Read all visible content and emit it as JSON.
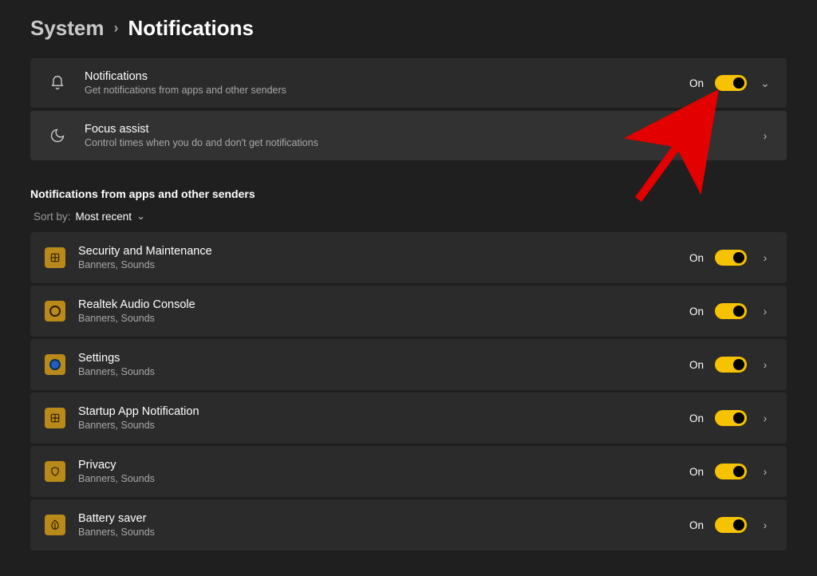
{
  "breadcrumb": {
    "parent": "System",
    "current": "Notifications"
  },
  "main_toggle": {
    "title": "Notifications",
    "subtitle": "Get notifications from apps and other senders",
    "state": "On"
  },
  "focus": {
    "title": "Focus assist",
    "subtitle": "Control times when you do and don't get notifications"
  },
  "section_heading": "Notifications from apps and other senders",
  "sort": {
    "label": "Sort by:",
    "value": "Most recent"
  },
  "apps": [
    {
      "name": "Security and Maintenance",
      "sub": "Banners, Sounds",
      "state": "On",
      "icon": "grid"
    },
    {
      "name": "Realtek Audio Console",
      "sub": "Banners, Sounds",
      "state": "On",
      "icon": "circle"
    },
    {
      "name": "Settings",
      "sub": "Banners, Sounds",
      "state": "On",
      "icon": "blue-dot"
    },
    {
      "name": "Startup App Notification",
      "sub": "Banners, Sounds",
      "state": "On",
      "icon": "grid"
    },
    {
      "name": "Privacy",
      "sub": "Banners, Sounds",
      "state": "On",
      "icon": "shield"
    },
    {
      "name": "Battery saver",
      "sub": "Banners, Sounds",
      "state": "On",
      "icon": "leaf"
    }
  ]
}
